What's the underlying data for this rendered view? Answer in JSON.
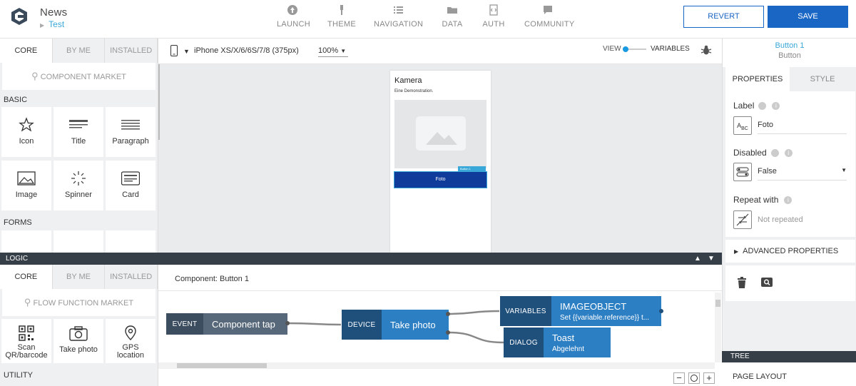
{
  "app": {
    "title": "News",
    "subtitle": "Test"
  },
  "nav": [
    {
      "label": "LAUNCH",
      "icon": "rocket-icon"
    },
    {
      "label": "THEME",
      "icon": "brush-icon"
    },
    {
      "label": "NAVIGATION",
      "icon": "list-icon"
    },
    {
      "label": "DATA",
      "icon": "folder-icon"
    },
    {
      "label": "AUTH",
      "icon": "code-file-icon"
    },
    {
      "label": "COMMUNITY",
      "icon": "chat-icon"
    }
  ],
  "actions": {
    "revert": "REVERT",
    "save": "SAVE"
  },
  "palette": {
    "tabs": [
      "CORE",
      "BY ME",
      "INSTALLED"
    ],
    "market": "COMPONENT MARKET",
    "basic_header": "BASIC",
    "basic": [
      "Icon",
      "Title",
      "Paragraph",
      "Image",
      "Spinner",
      "Card"
    ],
    "forms_header": "FORMS"
  },
  "canvas": {
    "device": "iPhone XS/X/6/6S/7/8 (375px)",
    "zoom": "100%",
    "view_label": "VIEW",
    "variables_label": "VARIABLES"
  },
  "phone": {
    "heading": "Kamera",
    "text": "Eine Demonstration.",
    "selected_tag": "Button 1",
    "button_label": "Foto"
  },
  "inspector": {
    "component_name": "Button 1",
    "component_type": "Button",
    "tabs": [
      "PROPERTIES",
      "STYLE"
    ],
    "label_title": "Label",
    "label_value": "Foto",
    "disabled_title": "Disabled",
    "disabled_value": "False",
    "repeat_title": "Repeat with",
    "repeat_value": "Not repeated",
    "advanced": "ADVANCED PROPERTIES"
  },
  "logic": {
    "bar_title": "LOGIC",
    "tabs": [
      "CORE",
      "BY ME",
      "INSTALLED"
    ],
    "market": "FLOW FUNCTION MARKET",
    "functions": [
      "Scan QR/barcode",
      "Take photo",
      "GPS location"
    ],
    "utility_header": "UTILITY",
    "component_label": "Component: Button 1",
    "nodes": {
      "event": {
        "type": "EVENT",
        "label": "Component tap"
      },
      "device": {
        "type": "DEVICE",
        "label": "Take photo"
      },
      "variables": {
        "type": "VARIABLES",
        "label": "IMAGEOBJECT",
        "sub": "Set {{variable.reference}} t..."
      },
      "dialog": {
        "type": "DIALOG",
        "label": "Toast",
        "sub": "Abgelehnt"
      }
    }
  },
  "tree": {
    "title": "TREE",
    "page_layout": "PAGE LAYOUT"
  },
  "colors": {
    "accent": "#1a66c4",
    "dark_bar": "#363f48",
    "node_dark": "#1f4f7b",
    "node_light": "#2d7fc4",
    "link": "#39a7d8"
  }
}
